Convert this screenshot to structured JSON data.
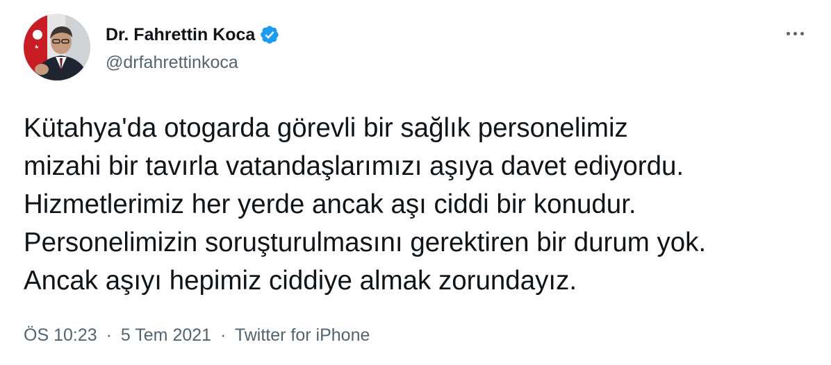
{
  "author": {
    "display_name": "Dr. Fahrettin Koca",
    "handle": "@drfahrettinkoca",
    "verified": true,
    "avatar_icon": "profile-photo"
  },
  "menu_icon": "more-horizontal-icon",
  "tweet": {
    "text": "Kütahya'da otogarda görevli bir sağlık personelimiz\nmizahi bir tavırla vatandaşlarımızı aşıya davet ediyordu.\nHizmetlerimiz her yerde ancak aşı ciddi bir konudur.\nPersonelimizin soruşturulmasını gerektiren bir durum yok.\nAncak aşıyı hepimiz ciddiye almak zorundayız."
  },
  "meta": {
    "time": "ÖS 10:23",
    "date": "5 Tem 2021",
    "separator": "·",
    "source": "Twitter for iPhone"
  },
  "colors": {
    "verified_blue": "#1d9bf0",
    "secondary_text": "#536471",
    "primary_text": "#0f1419"
  }
}
